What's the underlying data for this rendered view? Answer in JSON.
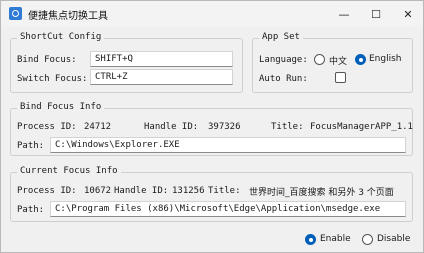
{
  "window": {
    "title": "便捷焦点切换工具",
    "controls": {
      "minimize": "—",
      "maximize": "☐",
      "close": "✕"
    }
  },
  "shortcut": {
    "legend": "ShortCut Config",
    "bind_label": "Bind  Focus:",
    "bind_value": "SHIFT+Q",
    "switch_label": "Switch Focus:",
    "switch_value": "CTRL+Z"
  },
  "appset": {
    "legend": "App Set",
    "language_label": "Language:",
    "lang_zh": "中文",
    "lang_en": "English",
    "selected_language": "English",
    "autorun_label": "Auto Run:",
    "autorun_checked": false
  },
  "bind_info": {
    "legend": "Bind Focus Info",
    "pid_label": "Process ID:",
    "pid": "24712",
    "handle_label": "Handle ID:",
    "handle": "397326",
    "title_label": "Title:",
    "title": "FocusManagerAPP_1.1",
    "path_label": "Path:",
    "path": "C:\\Windows\\Explorer.EXE"
  },
  "current_info": {
    "legend": "Current Focus Info",
    "pid_label": "Process ID:",
    "pid": "10672",
    "handle_label": "Handle ID:",
    "handle": "131256",
    "title_label": "Title:",
    "title": "世界时间_百度搜索 和另外 3 个页面",
    "path_label": "Path:",
    "path": "C:\\Program Files (x86)\\Microsoft\\Edge\\Application\\msedge.exe"
  },
  "footer": {
    "enable_label": "Enable",
    "disable_label": "Disable",
    "selected": "Enable"
  },
  "colors": {
    "accent": "#005fb8",
    "background": "#f0f0f0"
  }
}
